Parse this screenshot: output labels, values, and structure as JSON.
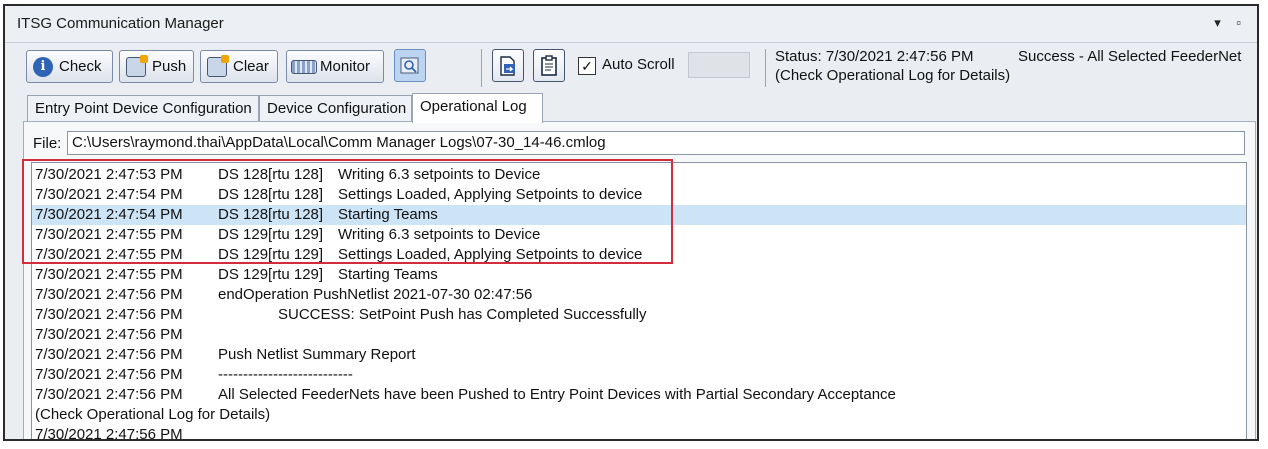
{
  "window": {
    "title": "ITSG Communication Manager",
    "controls": "▾ ▫"
  },
  "toolbar": {
    "check_label": "Check",
    "push_label": "Push",
    "clear_label": "Clear",
    "monitor_label": "Monitor",
    "auto_scroll_label": "Auto Scroll",
    "auto_scroll_checked": "✓",
    "status_line1": "Status: 7/30/2021 2:47:56 PM",
    "status_line2": "(Check Operational Log for Details)",
    "status_result": "Success - All Selected FeederNet"
  },
  "tabs": [
    {
      "label": "Entry Point Device Configuration"
    },
    {
      "label": "Device Configuration"
    },
    {
      "label": "Operational Log",
      "active": true
    }
  ],
  "file": {
    "label": "File:",
    "path": "C:\\Users\\raymond.thai\\AppData\\Local\\Comm Manager Logs\\07-30_14-46.cmlog"
  },
  "log": [
    {
      "time": "7/30/2021 2:47:53 PM",
      "device": "DS 128[rtu 128]",
      "message": "Writing 6.3 setpoints to Device"
    },
    {
      "time": "7/30/2021 2:47:54 PM",
      "device": "DS 128[rtu 128]",
      "message": "Settings Loaded, Applying Setpoints to device"
    },
    {
      "time": "7/30/2021 2:47:54 PM",
      "device": "DS 128[rtu 128]",
      "message": "Starting Teams"
    },
    {
      "time": "7/30/2021 2:47:55 PM",
      "device": "DS 129[rtu 129]",
      "message": "Writing 6.3 setpoints to Device"
    },
    {
      "time": "7/30/2021 2:47:55 PM",
      "device": "DS 129[rtu 129]",
      "message": "Settings Loaded, Applying Setpoints to device"
    },
    {
      "time": "7/30/2021 2:47:55 PM",
      "device": "DS 129[rtu 129]",
      "message": "Starting Teams"
    },
    {
      "time": "7/30/2021 2:47:56 PM",
      "device": "",
      "message": "endOperation PushNetlist  2021-07-30 02:47:56"
    },
    {
      "time": "7/30/2021 2:47:56 PM",
      "device": "",
      "message": "SUCCESS: SetPoint Push has Completed Successfully"
    },
    {
      "time": "7/30/2021 2:47:56 PM",
      "device": "",
      "message": ""
    },
    {
      "time": "7/30/2021 2:47:56 PM",
      "device": "",
      "message": "Push Netlist Summary Report"
    },
    {
      "time": "7/30/2021 2:47:56 PM",
      "device": "",
      "message": "---------------------------"
    },
    {
      "time": "7/30/2021 2:47:56 PM",
      "device": "",
      "message": "All Selected FeederNets have been Pushed to Entry Point Devices with Partial Secondary Acceptance"
    },
    {
      "time": "(Check Operational Log for Details)",
      "device": "",
      "message": ""
    },
    {
      "time": "7/30/2021 2:47:56 PM",
      "device": "",
      "message": ""
    }
  ]
}
